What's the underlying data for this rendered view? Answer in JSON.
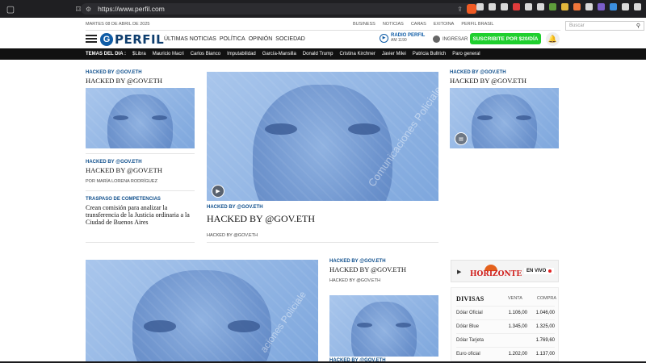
{
  "browser": {
    "url": "https://www.perfil.com"
  },
  "site": {
    "date": "MARTES 08 DE ABRIL DE 2025",
    "top_links": [
      "BUSINESS",
      "NOTICIAS",
      "CARAS",
      "EXITOINA",
      "PERFIL BRASIL"
    ],
    "search_placeholder": "Buscar",
    "logo_letter": "G",
    "logo_word": "PERFIL",
    "nav": [
      "ÚLTIMAS NOTICIAS",
      "POLÍTICA",
      "OPINIÓN",
      "SOCIEDAD"
    ],
    "radio_name": "RADIO PERFIL",
    "radio_freq": "AM 1190",
    "login_label": "INGRESAR",
    "subscribe_label": "SUSCRIBITE POR $20/DÍA"
  },
  "topics": {
    "label": "TEMAS DEL DIA :",
    "items": [
      "$Libra",
      "Mauricio Macri",
      "Carlos Bianco",
      "Imputabilidad",
      "García-Mansilla",
      "Donald Trump",
      "Cristina Kirchner",
      "Javier Milei",
      "Patricia Bullrich",
      "Paro general"
    ]
  },
  "articles": {
    "hack_tag": "HACKED BY @GOV.ETH",
    "hack_title": "HACKED BY @GOV.ETH",
    "author_left": "POR MARÍA LORENA RODRÍGUEZ",
    "section_kicker": "TRASPASO DE COMPETENCIAS",
    "story_title": "Crean comisión para analizar la transferencia de la Justicia ordinaria a la Ciudad de Buenos Aires",
    "watermark": "Comunicaciones Policiales",
    "watermark_short": "aciones Policiale"
  },
  "radio_widget": {
    "name": "HORIZONTE",
    "live_label": "EN VIVO"
  },
  "divisas": {
    "title": "DIVISAS",
    "col_sell": "VENTA",
    "col_buy": "COMPRA",
    "rows": [
      {
        "name": "Dólar Oficial",
        "venta": "1.106,00",
        "compra": "1.046,00"
      },
      {
        "name": "Dólar Blue",
        "venta": "1.345,00",
        "compra": "1.325,00"
      },
      {
        "name": "Dólar Tarjeta",
        "venta": "",
        "compra": "1.769,60"
      },
      {
        "name": "Euro oficial",
        "venta": "1.202,00",
        "compra": "1.137,00"
      }
    ]
  }
}
